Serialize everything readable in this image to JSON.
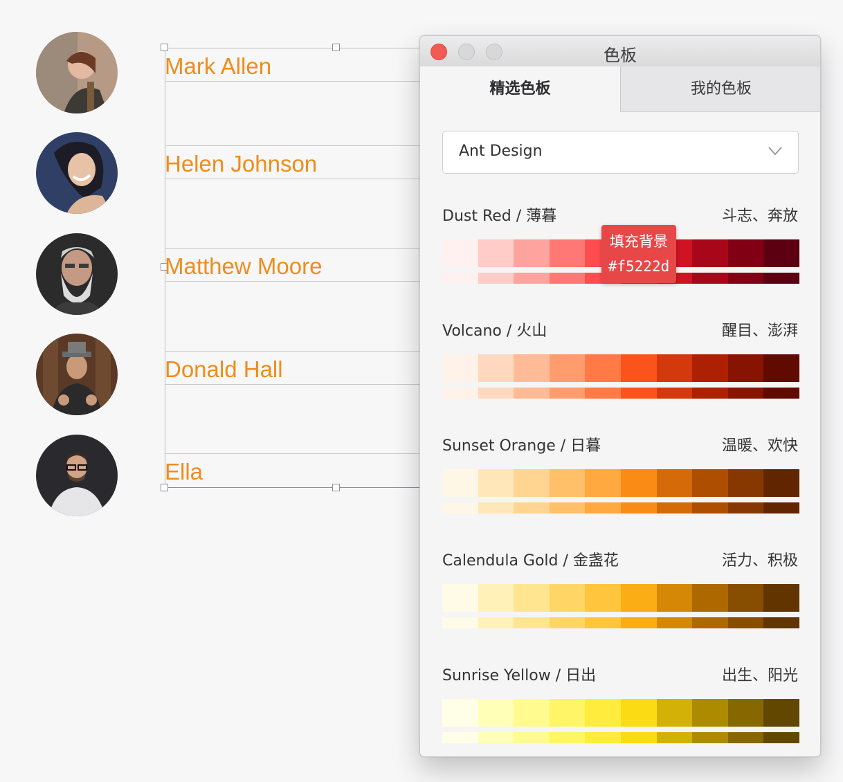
{
  "people": [
    {
      "name": "Mark Allen"
    },
    {
      "name": "Helen Johnson"
    },
    {
      "name": "Matthew Moore"
    },
    {
      "name": "Donald Hall"
    },
    {
      "name": "Ella"
    }
  ],
  "window": {
    "title": "色板",
    "tabs": [
      {
        "label": "精选色板",
        "active": true
      },
      {
        "label": "我的色板",
        "active": false
      }
    ],
    "library_select": {
      "value": "Ant Design",
      "icon": "chevron-down-icon"
    },
    "tooltip": {
      "label": "填充背景",
      "hex": "#f5222d"
    },
    "palettes": [
      {
        "name": "Dust Red / 薄暮",
        "desc": "斗志、奔放",
        "colors": [
          "#fff1f0",
          "#ffccc7",
          "#ffa39e",
          "#ff7875",
          "#ff4d4f",
          "#f5222d",
          "#cf1322",
          "#a8071a",
          "#820014",
          "#5c0011"
        ]
      },
      {
        "name": "Volcano / 火山",
        "desc": "醒目、澎湃",
        "colors": [
          "#fff2e8",
          "#ffd8bf",
          "#ffbb96",
          "#ff9c6e",
          "#ff7a45",
          "#fa541c",
          "#d4380d",
          "#ad2102",
          "#871400",
          "#610b00"
        ]
      },
      {
        "name": "Sunset Orange / 日暮",
        "desc": "温暖、欢快",
        "colors": [
          "#fff7e6",
          "#ffe7ba",
          "#ffd591",
          "#ffc069",
          "#ffa940",
          "#fa8c16",
          "#d46b08",
          "#ad4e00",
          "#873800",
          "#612500"
        ]
      },
      {
        "name": "Calendula Gold / 金盏花",
        "desc": "活力、积极",
        "colors": [
          "#fffbe6",
          "#fff1b8",
          "#ffe58f",
          "#ffd666",
          "#ffc53d",
          "#faad14",
          "#d48806",
          "#ad6800",
          "#874d00",
          "#613400"
        ]
      },
      {
        "name": "Sunrise Yellow / 日出",
        "desc": "出生、阳光",
        "colors": [
          "#feffe6",
          "#ffffb8",
          "#fffb8f",
          "#fff566",
          "#ffec3d",
          "#fadb14",
          "#d4b106",
          "#ad8b00",
          "#876800",
          "#614700"
        ]
      }
    ]
  },
  "colors": {
    "name_text": "#f08c1b",
    "tooltip_bg": "#e84747"
  }
}
